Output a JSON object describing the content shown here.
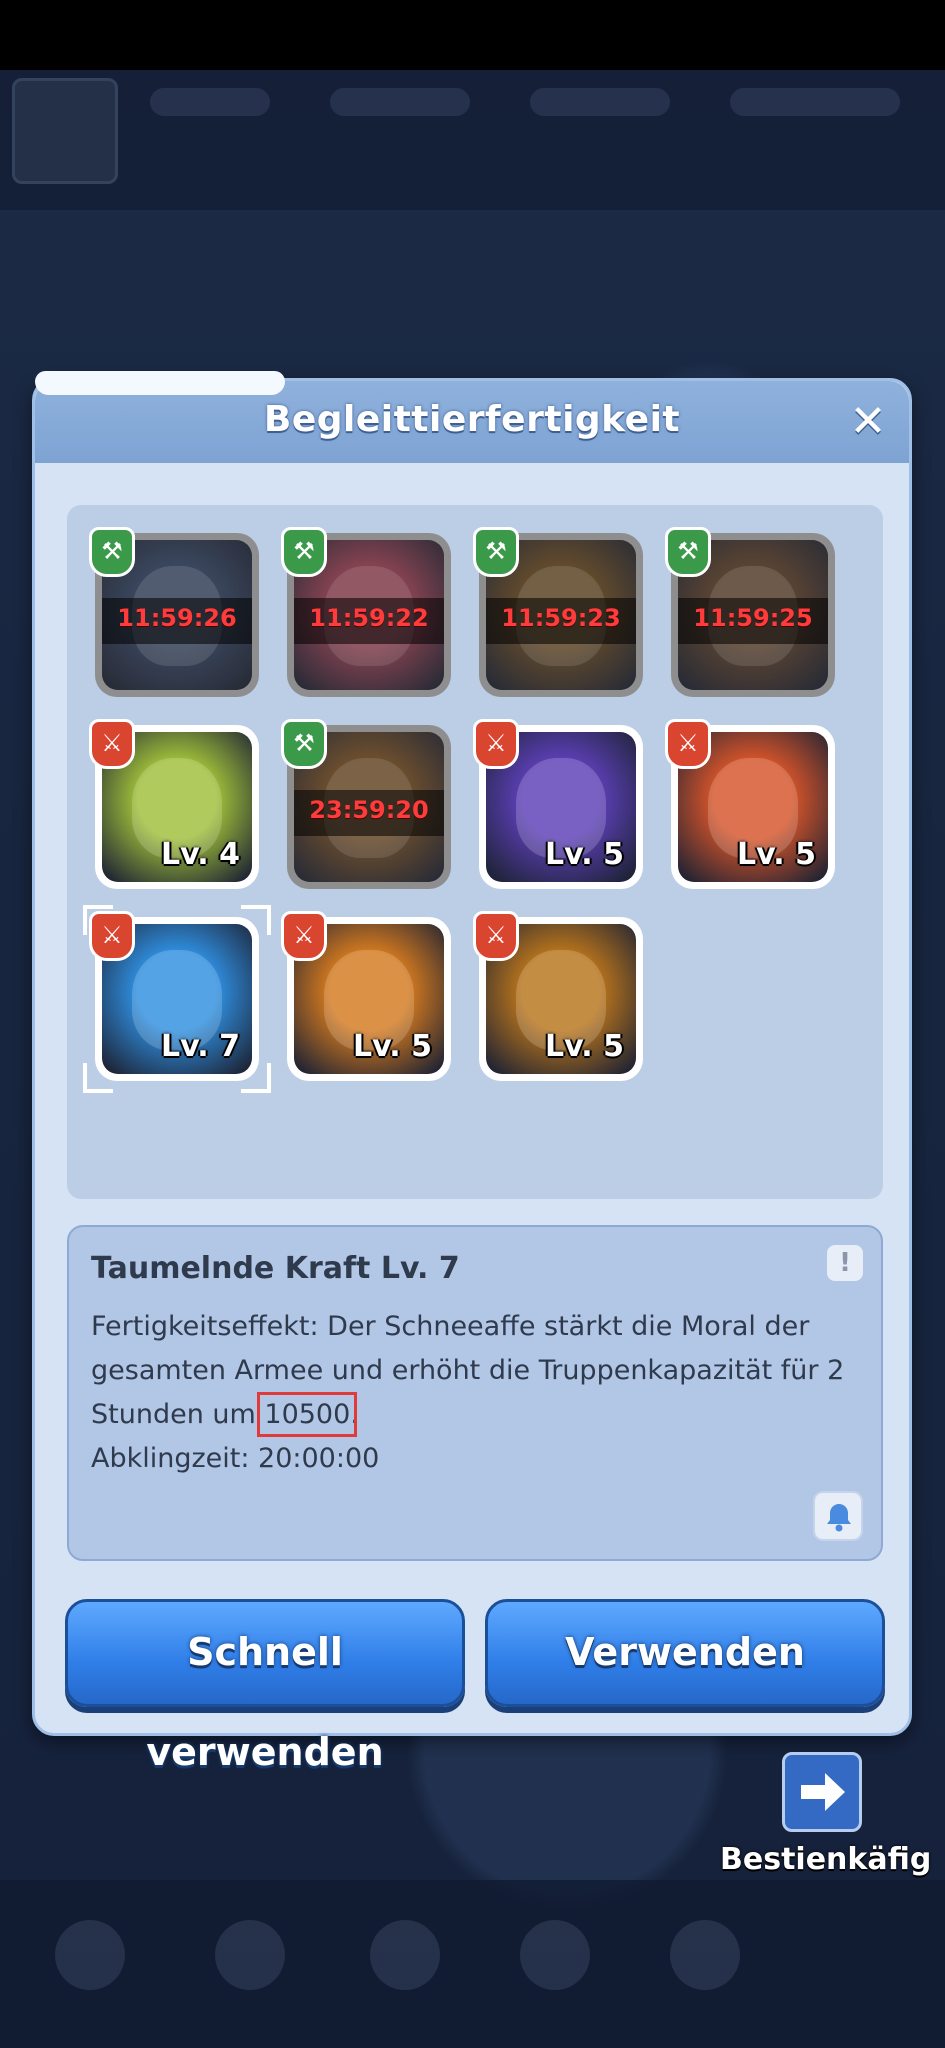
{
  "dialog": {
    "title": "Begleittierfertigkeit",
    "close_icon": "close-icon"
  },
  "pets": [
    {
      "state": "busy",
      "badge": "build",
      "timer": "11:59:26",
      "level": "",
      "theme": "#3b4f73"
    },
    {
      "state": "busy",
      "badge": "build",
      "timer": "11:59:22",
      "level": "",
      "theme": "#b4485f"
    },
    {
      "state": "busy",
      "badge": "build",
      "timer": "11:59:23",
      "level": "",
      "theme": "#7a5524"
    },
    {
      "state": "busy",
      "badge": "build",
      "timer": "11:59:25",
      "level": "",
      "theme": "#6d4a2e"
    },
    {
      "state": "ready",
      "badge": "attack",
      "timer": "",
      "level": "Lv. 4",
      "theme": "#9fbf3a"
    },
    {
      "state": "busy",
      "badge": "build",
      "timer": "23:59:20",
      "level": "",
      "theme": "#8a5a26"
    },
    {
      "state": "ready",
      "badge": "attack",
      "timer": "",
      "level": "Lv. 5",
      "theme": "#5b3fb5"
    },
    {
      "state": "ready",
      "badge": "attack",
      "timer": "",
      "level": "Lv. 5",
      "theme": "#d5542a"
    },
    {
      "state": "ready",
      "badge": "attack",
      "timer": "",
      "level": "Lv. 7",
      "theme": "#2f8fe0",
      "selected": true
    },
    {
      "state": "ready",
      "badge": "attack",
      "timer": "",
      "level": "Lv. 5",
      "theme": "#d47a1f"
    },
    {
      "state": "ready",
      "badge": "attack",
      "timer": "",
      "level": "Lv. 5",
      "theme": "#b8741c"
    }
  ],
  "skill": {
    "name": "Taumelnde Kraft Lv. 7",
    "effect_prefix": "Fertigkeitseffekt: Der Schneeaffe stärkt die Moral der gesamten Armee und erhöht die Truppenkapazität für 2 Stunden um ",
    "effect_value": "10500",
    "effect_suffix": ".",
    "cooldown": "Abklingzeit: 20:00:00"
  },
  "buttons": {
    "quick_use": "Schnell verwenden",
    "use": "Verwenden"
  },
  "cage": {
    "label": "Bestienkäfig",
    "icon": "arrow-right-icon"
  },
  "colors": {
    "accent_blue": "#2f7ee8",
    "timer_red": "#ff3b3b",
    "highlight_red": "#e03a3a"
  }
}
